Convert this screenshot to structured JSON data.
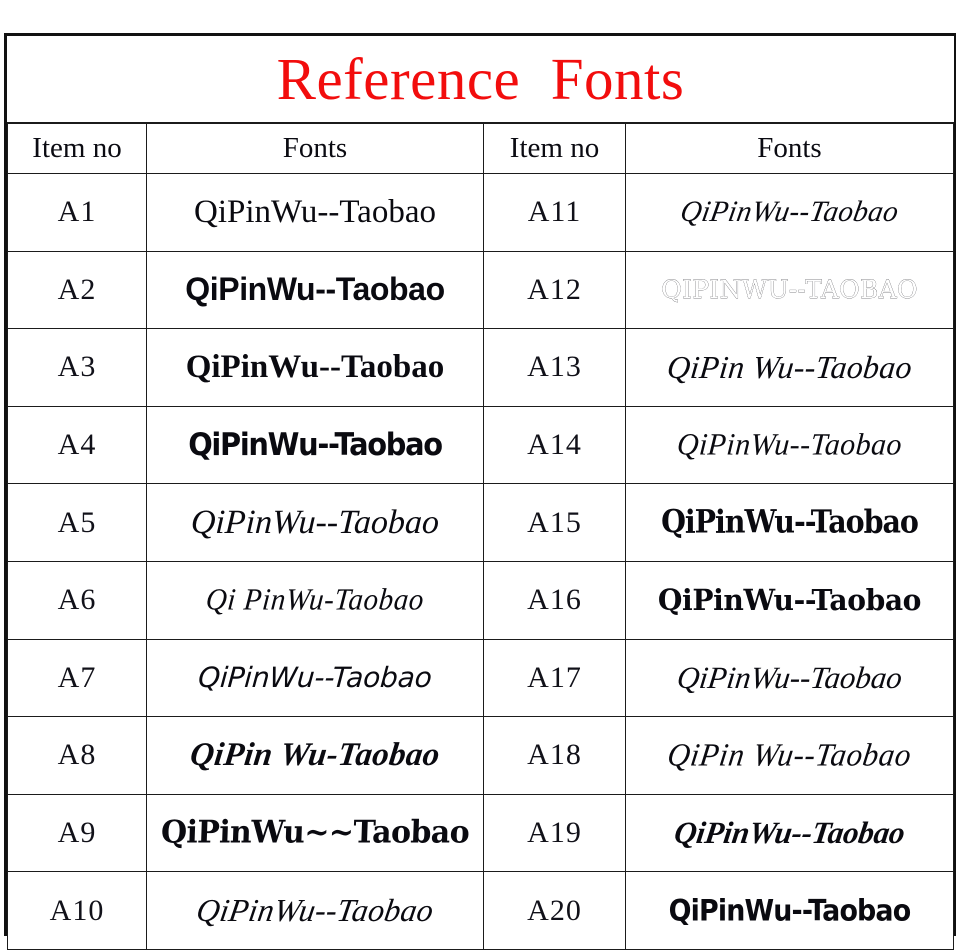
{
  "title": "Reference  Fonts",
  "title_color": "#f20d0d",
  "header": {
    "item_no_left": "Item no",
    "fonts_left": "Fonts",
    "item_no_right": "Item no",
    "fonts_right": "Fonts"
  },
  "left_column": [
    {
      "item_no": "A1",
      "sample": "QiPinWu--Taobao",
      "style": "serif regular"
    },
    {
      "item_no": "A2",
      "sample": "QiPinWu--Taobao",
      "style": "sans-serif bold"
    },
    {
      "item_no": "A3",
      "sample": "QiPinWu--Taobao",
      "style": "serif bold"
    },
    {
      "item_no": "A4",
      "sample": "QiPinWu--Taobao",
      "style": "heavy condensed geometric sans"
    },
    {
      "item_no": "A5",
      "sample": "QiPinWu--Taobao",
      "style": "italic serif script"
    },
    {
      "item_no": "A6",
      "sample": "Qi PinWu-Taobao",
      "style": "calligraphic chancery script"
    },
    {
      "item_no": "A7",
      "sample": "QiPinWu--Taobao",
      "style": "light italic handwriting sans"
    },
    {
      "item_no": "A8",
      "sample": "QiPin Wu-Taobao",
      "style": "calligraphic uncial italic"
    },
    {
      "item_no": "A9",
      "sample": "QiPinWu~~Taobao",
      "style": "gothic uncial calligraphic"
    },
    {
      "item_no": "A10",
      "sample": "QiPinWu--Taobao",
      "style": "ornate flowing swash script"
    }
  ],
  "right_column": [
    {
      "item_no": "A11",
      "sample": "QiPinWu--Taobao",
      "style": "fine copperplate script"
    },
    {
      "item_no": "A12",
      "sample": "QIPINWU--TAOBAO",
      "style": "thin outlined whimsical caps"
    },
    {
      "item_no": "A13",
      "sample": "QiPin Wu--Taobao",
      "style": "script with heart ornaments"
    },
    {
      "item_no": "A14",
      "sample": "QiPinWu--Taobao",
      "style": "light rounded script"
    },
    {
      "item_no": "A15",
      "sample": "QiPinWu--Taobao",
      "style": "heavy blackletter fraktur"
    },
    {
      "item_no": "A16",
      "sample": "QiPinWu--Taobao",
      "style": "old english blackletter"
    },
    {
      "item_no": "A17",
      "sample": "QiPinWu--Taobao",
      "style": "brush italic script"
    },
    {
      "item_no": "A18",
      "sample": "QiPin Wu--Taobao",
      "style": "fine chancery calligraphic italic"
    },
    {
      "item_no": "A19",
      "sample": "QiPinWu--Taobao",
      "style": "bold brush script"
    },
    {
      "item_no": "A20",
      "sample": "QiPinWu--Taobao",
      "style": "heavy bold condensed sans"
    }
  ]
}
